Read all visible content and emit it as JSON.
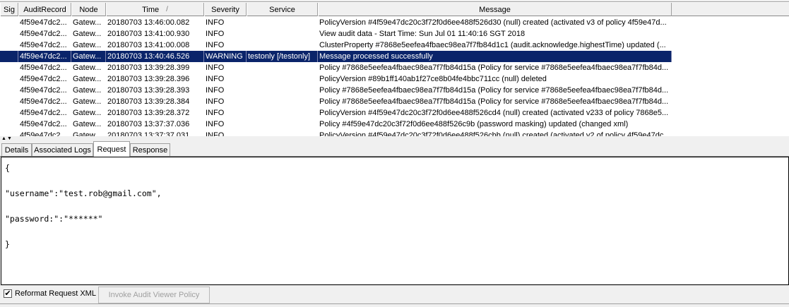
{
  "columns": [
    {
      "key": "sig",
      "label": "Sig"
    },
    {
      "key": "audit_record",
      "label": "AuditRecord"
    },
    {
      "key": "node",
      "label": "Node"
    },
    {
      "key": "time",
      "label": "Time"
    },
    {
      "key": "severity",
      "label": "Severity"
    },
    {
      "key": "service",
      "label": "Service"
    },
    {
      "key": "message",
      "label": "Message"
    }
  ],
  "time_sort_indicator": "/",
  "rows": [
    {
      "sig": "",
      "audit_record": "4f59e47dc2...",
      "node": "Gatew...",
      "time": "20180703 13:46:00.082",
      "severity": "INFO",
      "service": "",
      "message": "PolicyVersion #4f59e47dc20c3f72f0d6ee488f526d30 (null) created (activated v3 of policy 4f59e47d...",
      "selected": false
    },
    {
      "sig": "",
      "audit_record": "4f59e47dc2...",
      "node": "Gatew...",
      "time": "20180703 13:41:00.930",
      "severity": "INFO",
      "service": "",
      "message": "View audit data - Start Time: Sun Jul 01 11:40:16 SGT 2018",
      "selected": false
    },
    {
      "sig": "",
      "audit_record": "4f59e47dc2...",
      "node": "Gatew...",
      "time": "20180703 13:41:00.008",
      "severity": "INFO",
      "service": "",
      "message": "ClusterProperty #7868e5eefea4fbaec98ea7f7fb84d1c1 (audit.acknowledge.highestTime) updated (...",
      "selected": false
    },
    {
      "sig": "",
      "audit_record": "4f59e47dc2...",
      "node": "Gatew...",
      "time": "20180703 13:40:46.526",
      "severity": "WARNING",
      "service": "testonly [/testonly]",
      "message": "Message processed successfully",
      "selected": true
    },
    {
      "sig": "",
      "audit_record": "4f59e47dc2...",
      "node": "Gatew...",
      "time": "20180703 13:39:28.399",
      "severity": "INFO",
      "service": "",
      "message": "Policy #7868e5eefea4fbaec98ea7f7fb84d15a (Policy for service #7868e5eefea4fbaec98ea7f7fb84d...",
      "selected": false
    },
    {
      "sig": "",
      "audit_record": "4f59e47dc2...",
      "node": "Gatew...",
      "time": "20180703 13:39:28.396",
      "severity": "INFO",
      "service": "",
      "message": "PolicyVersion #89b1ff140ab1f27ce8b04fe4bbc711cc (null) deleted",
      "selected": false
    },
    {
      "sig": "",
      "audit_record": "4f59e47dc2...",
      "node": "Gatew...",
      "time": "20180703 13:39:28.393",
      "severity": "INFO",
      "service": "",
      "message": "Policy #7868e5eefea4fbaec98ea7f7fb84d15a (Policy for service #7868e5eefea4fbaec98ea7f7fb84d...",
      "selected": false
    },
    {
      "sig": "",
      "audit_record": "4f59e47dc2...",
      "node": "Gatew...",
      "time": "20180703 13:39:28.384",
      "severity": "INFO",
      "service": "",
      "message": "Policy #7868e5eefea4fbaec98ea7f7fb84d15a (Policy for service #7868e5eefea4fbaec98ea7f7fb84d...",
      "selected": false
    },
    {
      "sig": "",
      "audit_record": "4f59e47dc2...",
      "node": "Gatew...",
      "time": "20180703 13:39:28.372",
      "severity": "INFO",
      "service": "",
      "message": "PolicyVersion #4f59e47dc20c3f72f0d6ee488f526cd4 (null) created (activated v233 of policy 7868e5...",
      "selected": false
    },
    {
      "sig": "",
      "audit_record": "4f59e47dc2...",
      "node": "Gatew...",
      "time": "20180703 13:37:37.036",
      "severity": "INFO",
      "service": "",
      "message": "Policy #4f59e47dc20c3f72f0d6ee488f526c9b (password masking) updated (changed xml)",
      "selected": false
    },
    {
      "sig": "",
      "audit_record": "4f59e47dc2...",
      "node": "Gatew...",
      "time": "20180703 13:37:37.031",
      "severity": "INFO",
      "service": "",
      "message": "PolicyVersion #4f59e47dc20c3f72f0d6ee488f526cbb (null) created (activated v2 of policy 4f59e47dc...",
      "selected": false
    }
  ],
  "tabs": [
    {
      "label": "Details",
      "active": false
    },
    {
      "label": "Associated Logs",
      "active": false
    },
    {
      "label": "Request",
      "active": true
    },
    {
      "label": "Response",
      "active": false
    }
  ],
  "request_body": "{\n\n\"username\":\"test.rob@gmail.com\",\n\n\"password:\":\"******\"\n\n}",
  "reformat_label": "Reformat Request XML",
  "reformat_checked": true,
  "invoke_button_label": "Invoke Audit Viewer Policy",
  "colors": {
    "selection": "#0a246a",
    "panel": "#f0f0f0",
    "disabled_text": "#a0a0a0"
  }
}
